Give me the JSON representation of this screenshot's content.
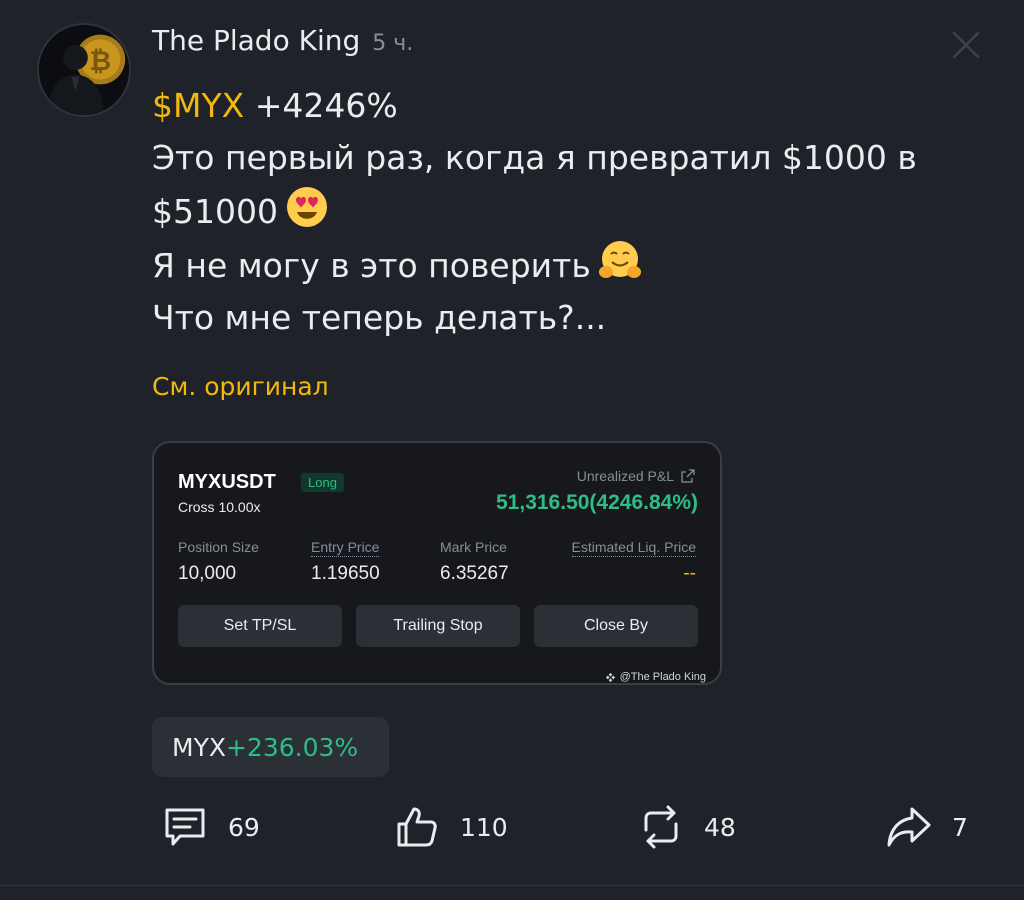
{
  "post": {
    "author": "The Plado King",
    "time_ago": "5 ч.",
    "ticker": "$MYX",
    "change": "+4246%",
    "lines": [
      "Это первый раз, когда я превратил $1000 в",
      "$51000",
      "Я не могу в это поверить",
      "Что мне теперь делать?..."
    ],
    "see_original": "См. оригинал"
  },
  "trade_card": {
    "symbol": "MYXUSDT",
    "side": "Long",
    "margin_mode": "Cross 10.00x",
    "pnl_label": "Unrealized P&L",
    "pnl_value": "51,316.50(4246.84%)",
    "stats": [
      {
        "label": "Position Size",
        "value": "10,000"
      },
      {
        "label": "Entry Price",
        "value": "1.19650"
      },
      {
        "label": "Mark Price",
        "value": "6.35267"
      },
      {
        "label": "Estimated Liq. Price",
        "value": "--"
      }
    ],
    "buttons": [
      "Set TP/SL",
      "Trailing Stop",
      "Close By"
    ],
    "watermark": "@The Plado King"
  },
  "coin_chip": {
    "ticker": "MYX",
    "change": "+236.03%"
  },
  "actions": {
    "comments": "69",
    "likes": "110",
    "reposts": "48",
    "shares": "7"
  },
  "colors": {
    "background": "#1f2229",
    "accent": "#f0b90b",
    "positive": "#2ebd85",
    "card": "#17181c",
    "button": "#2b2f36"
  },
  "icons": [
    "close-icon",
    "heart-eyes-emoji",
    "hugging-face-emoji",
    "share-icon",
    "comment-icon",
    "thumbs-up-icon",
    "repost-icon",
    "share-arrow-icon"
  ]
}
